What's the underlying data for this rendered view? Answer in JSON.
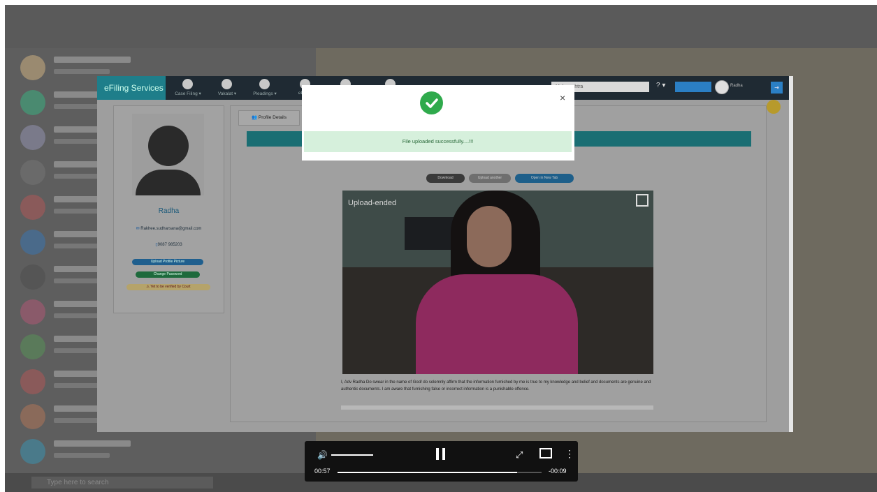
{
  "background": {
    "chat_header_title": "",
    "taskbar_search_placeholder": "Type here to search"
  },
  "efiling": {
    "brand": "eFiling Services",
    "nav": [
      {
        "label": "Case Filing ▾",
        "icon": "pencil-icon"
      },
      {
        "label": "Vakalat ▾",
        "icon": "document-icon"
      },
      {
        "label": "Pleadings ▾",
        "icon": "file-icon"
      },
      {
        "label": "ePaym",
        "icon": "payment-icon"
      },
      {
        "label": "",
        "icon": "folder-icon"
      },
      {
        "label": "",
        "icon": "menu-icon"
      }
    ],
    "state_select": "Maharashtra",
    "help": "? ▾",
    "user_name": "Radha"
  },
  "profile": {
    "name": "Radha",
    "email": "Rakhee.sudharsana@gmail.com",
    "phone": "9087 985203",
    "upload_photo": "Upload Profile Picture",
    "change_password": "Change Password",
    "status": "Yet to be verified by Court"
  },
  "tabs": {
    "profile_details": "Profile Details"
  },
  "media_buttons": {
    "download": "Download",
    "upload_another": "Upload another",
    "open_new_tab": "Open in New Tab"
  },
  "video": {
    "label": "Upload-ended"
  },
  "declaration": "I, Adv Radha Do swear in the name of God/ do solemnly affirm that the information furnished by me is true to my knowledge and belief and documents are genuine and authentic documents. I am aware that furnishing false or incorrect information is a punishable offence.",
  "dialog": {
    "message": "File uploaded successfully....!!!",
    "close": "×"
  },
  "player": {
    "current_time": "00:57",
    "remaining_time": "-00:09",
    "progress": 0.88
  }
}
